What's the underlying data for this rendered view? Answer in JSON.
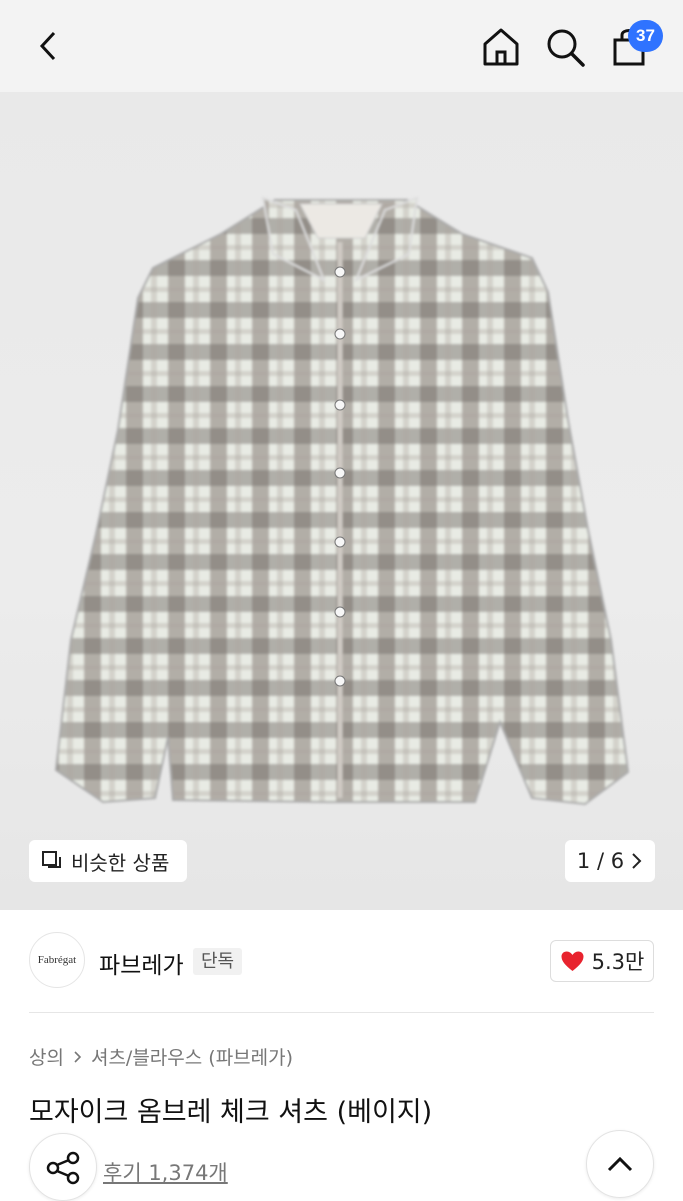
{
  "header": {
    "back_icon": "chevron-left-icon",
    "home_icon": "home-icon",
    "search_icon": "search-icon",
    "cart_icon": "shopping-bag-icon",
    "cart_count": "37",
    "accent": "#2f73ff"
  },
  "hero": {
    "similar_label": "비슷한 상품",
    "counter": "1 / 6"
  },
  "brand": {
    "logo_text": "Fabrégat",
    "name": "파브레가",
    "exclusive_label": "단독",
    "likes": "5.3만",
    "like_color": "#e8232e"
  },
  "product": {
    "breadcrumb": [
      "상의",
      "셔츠/블라우스 (파브레가)"
    ],
    "title": "모자이크 옴브레 체크 셔츠 (베이지)",
    "reviews": "후기 1,374개"
  }
}
